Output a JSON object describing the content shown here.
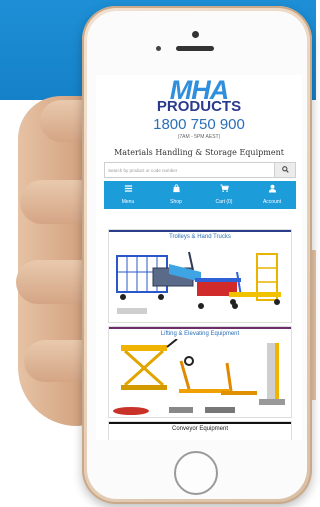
{
  "site": {
    "logo": "MHA",
    "products_label": "PRODUCTS",
    "phone": "1800 750 900",
    "hours": "(7AM - 5PM AEST)",
    "tagline": "Materials Handling & Storage Equipment"
  },
  "search": {
    "placeholder": "Search by product or code number",
    "button_icon": "search-icon"
  },
  "nav": {
    "items": [
      {
        "label": "Menu",
        "icon": "hamburger-icon"
      },
      {
        "label": "Shop",
        "icon": "shop-icon"
      },
      {
        "label": "Cart (0)",
        "icon": "cart-icon"
      },
      {
        "label": "Account",
        "icon": "user-icon"
      }
    ]
  },
  "categories": [
    {
      "title": "Trolleys & Hand Trucks"
    },
    {
      "title": "Lifting & Elevating Equipment"
    },
    {
      "title": "Conveyor Equipment"
    }
  ],
  "colors": {
    "nav_bg": "#1c9cd9",
    "brand_blue": "#2f8fdc",
    "brand_navy": "#2b3a8c",
    "band_bg": "#1581c8"
  }
}
